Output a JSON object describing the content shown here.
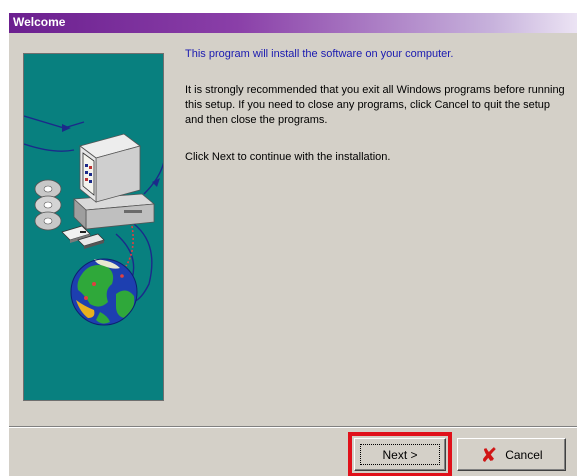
{
  "window": {
    "title": "Welcome"
  },
  "content": {
    "intro": "This program will install the software on your computer.",
    "warning": "It is strongly recommended that you exit all Windows programs before running this setup. If you need to close any programs, click Cancel to quit the setup and then close the programs.",
    "instruction": "Click Next to continue with the installation."
  },
  "buttons": {
    "next_label": "Next >",
    "cancel_label": "Cancel"
  },
  "colors": {
    "title_bar": "#6b1f8f",
    "side_panel": "#08807f",
    "intro_text": "#1a1ab0",
    "highlight": "#e0101a",
    "cancel_icon": "#d01515"
  },
  "icons": {
    "computer": "computer-icon",
    "cd": "cd-icon",
    "floppy": "floppy-icon",
    "globe": "globe-icon",
    "cancel": "x-icon"
  }
}
